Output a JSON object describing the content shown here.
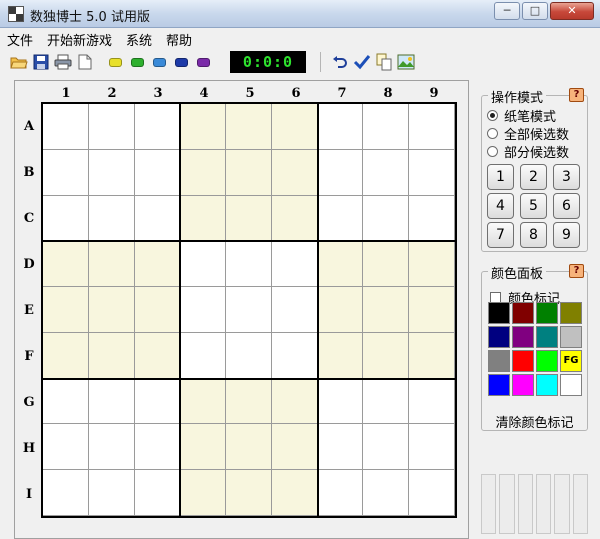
{
  "window": {
    "title": "数独博士 5.0 试用版",
    "min_btn": "─",
    "max_btn": "□",
    "close_btn": "✕"
  },
  "menu": [
    "文件",
    "开始新游戏",
    "系统",
    "帮助"
  ],
  "toolbar": {
    "timer": "0:0:0",
    "file_buttons": [
      "open-folder-icon",
      "save-icon",
      "print-icon",
      "new-file-icon"
    ],
    "color_gems": [
      "#e8e02a",
      "#2eb02e",
      "#3a8ad8",
      "#1d3aa8",
      "#7a2aa8"
    ],
    "action_buttons": [
      "undo-icon",
      "checkmark-icon",
      "copy-icon",
      "image-icon"
    ]
  },
  "board": {
    "columns": [
      "1",
      "2",
      "3",
      "4",
      "5",
      "6",
      "7",
      "8",
      "9"
    ],
    "rows": [
      "A",
      "B",
      "C",
      "D",
      "E",
      "F",
      "G",
      "H",
      "I"
    ]
  },
  "mode_panel": {
    "title": "操作模式",
    "help": "?",
    "options": [
      "纸笔模式",
      "全部候选数",
      "部分候选数"
    ],
    "selected": 0,
    "numbers": [
      "1",
      "2",
      "3",
      "4",
      "5",
      "6",
      "7",
      "8",
      "9"
    ]
  },
  "color_panel": {
    "title": "颜色面板",
    "help": "?",
    "checkbox_label": "颜色标记",
    "swatches": [
      "#000000",
      "#800000",
      "#008000",
      "#808000",
      "#000080",
      "#800080",
      "#008080",
      "#c0c0c0",
      "#808080",
      "#ff0000",
      "#00ff00",
      "#ffff00",
      "#0000ff",
      "#ff00ff",
      "#00ffff",
      "#ffffff"
    ],
    "fg_label": "FG",
    "clear_label": "清除颜色标记"
  }
}
